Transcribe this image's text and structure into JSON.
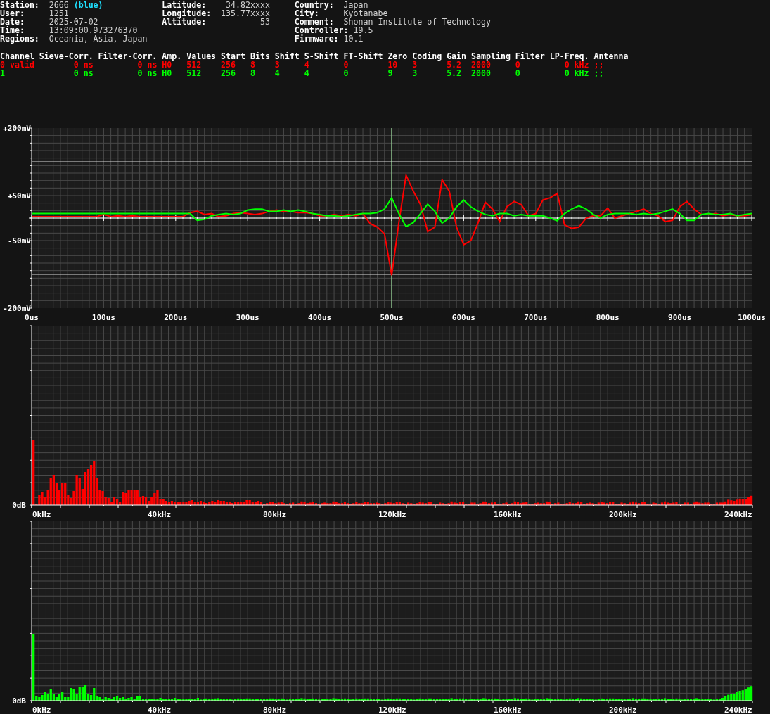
{
  "info_columns": [
    [
      {
        "label": "Station:",
        "value": "2666",
        "tag": "(blue)"
      },
      {
        "label": "User:",
        "value": "1251"
      },
      {
        "label": "Date:",
        "value": "2025-07-02"
      },
      {
        "label": "Time:",
        "value": "13:09:00.973276370"
      },
      {
        "label": "Regions:",
        "value": "Oceania, Asia, Japan"
      }
    ],
    [
      {
        "label": "Latitude:",
        "value": "34.82xxxx"
      },
      {
        "label": "Longitude:",
        "value": "135.77xxxx"
      },
      {
        "label": "Altitude:",
        "value": "53"
      }
    ],
    [
      {
        "label": "Country:",
        "value": "Japan"
      },
      {
        "label": "City:",
        "value": "Kyotanabe"
      },
      {
        "label": "Comment:",
        "value": "Shonan Institute of Technology"
      },
      {
        "label": "Controller:",
        "value": "19.5"
      },
      {
        "label": "Firmware:",
        "value": "10.1"
      }
    ]
  ],
  "channel_table": {
    "columns": [
      "Channel",
      "Sieve-Corr.",
      "Filter-Corr.",
      "Amp.",
      "Values",
      "Start",
      "Bits",
      "Shift",
      "S-Shift",
      "FT-Shift",
      "Zero",
      "Coding",
      "Gain",
      "Sampling",
      "Filter",
      "LP-Freq.",
      "Antenna"
    ],
    "rows": [
      {
        "color": "#ff0000",
        "cells": [
          "0 valid",
          "0 ns",
          "0 ns",
          "H0",
          "512",
          "256",
          "8",
          "3",
          "4",
          "0",
          "10",
          "3",
          "5.2",
          "2000",
          "0",
          "0 kHz",
          ";;"
        ]
      },
      {
        "color": "#00ff00",
        "cells": [
          "1",
          "0 ns",
          "0 ns",
          "H0",
          "512",
          "256",
          "8",
          "4",
          "4",
          "0",
          "9",
          "3",
          "5.2",
          "2000",
          "0",
          "0 kHz",
          ";;"
        ]
      }
    ]
  },
  "waveform": {
    "chart_data": {
      "type": "line",
      "ylim": [
        -200,
        200
      ],
      "xlim": [
        0,
        1000
      ],
      "x": [
        0,
        10,
        20,
        30,
        40,
        50,
        60,
        70,
        80,
        90,
        100,
        110,
        120,
        130,
        140,
        150,
        160,
        170,
        180,
        190,
        200,
        210,
        220,
        230,
        240,
        250,
        260,
        270,
        280,
        290,
        300,
        310,
        320,
        330,
        340,
        350,
        360,
        370,
        380,
        390,
        400,
        410,
        420,
        430,
        440,
        450,
        460,
        470,
        480,
        490,
        500,
        510,
        520,
        530,
        540,
        550,
        560,
        570,
        580,
        590,
        600,
        610,
        620,
        630,
        640,
        650,
        660,
        670,
        680,
        690,
        700,
        710,
        720,
        730,
        740,
        750,
        760,
        770,
        780,
        790,
        800,
        810,
        820,
        830,
        840,
        850,
        860,
        870,
        880,
        890,
        900,
        910,
        920,
        930,
        940,
        950,
        960,
        970,
        980,
        990,
        1000
      ],
      "series": [
        {
          "color": "#ff0000",
          "values": [
            3,
            3,
            3,
            3,
            3,
            3,
            3,
            3,
            3,
            3,
            8,
            3,
            5,
            3,
            5,
            3,
            3,
            3,
            3,
            3,
            3,
            3,
            12,
            15,
            8,
            10,
            3,
            5,
            10,
            12,
            10,
            8,
            10,
            15,
            18,
            15,
            15,
            12,
            12,
            10,
            5,
            5,
            8,
            5,
            8,
            5,
            10,
            -12,
            -20,
            -35,
            -127,
            -10,
            95,
            60,
            30,
            -30,
            -20,
            85,
            60,
            -20,
            -59,
            -50,
            -10,
            35,
            20,
            -8,
            25,
            37,
            30,
            5,
            10,
            40,
            45,
            55,
            -15,
            -23,
            -20,
            0,
            5,
            5,
            22,
            0,
            5,
            10,
            15,
            20,
            10,
            5,
            -8,
            -5,
            25,
            37,
            20,
            8,
            8,
            10,
            5,
            8,
            5,
            5,
            8
          ]
        },
        {
          "color": "#00ff00",
          "values": [
            10,
            10,
            10,
            10,
            10,
            10,
            10,
            10,
            10,
            10,
            10,
            10,
            10,
            10,
            10,
            10,
            10,
            10,
            10,
            10,
            10,
            10,
            10,
            -5,
            -3,
            5,
            8,
            10,
            8,
            10,
            18,
            20,
            20,
            15,
            15,
            18,
            15,
            18,
            15,
            10,
            8,
            5,
            5,
            3,
            5,
            8,
            10,
            10,
            12,
            20,
            45,
            10,
            -19,
            -10,
            10,
            31,
            15,
            -11,
            0,
            25,
            40,
            25,
            15,
            8,
            5,
            10,
            10,
            5,
            8,
            5,
            5,
            5,
            0,
            -6,
            10,
            20,
            27,
            20,
            8,
            0,
            8,
            10,
            10,
            10,
            8,
            10,
            8,
            10,
            15,
            20,
            10,
            -5,
            -5,
            8,
            10,
            8,
            8,
            10,
            5,
            8,
            10
          ]
        }
      ],
      "xticks": [
        {
          "value": 0,
          "label": "0us"
        },
        {
          "value": 100,
          "label": "100us"
        },
        {
          "value": 200,
          "label": "200us"
        },
        {
          "value": 300,
          "label": "300us"
        },
        {
          "value": 400,
          "label": "400us"
        },
        {
          "value": 500,
          "label": "500us"
        },
        {
          "value": 600,
          "label": "600us"
        },
        {
          "value": 700,
          "label": "700us"
        },
        {
          "value": 800,
          "label": "800us"
        },
        {
          "value": 900,
          "label": "900us"
        },
        {
          "value": 1000,
          "label": "1000us"
        }
      ],
      "yticks": [
        {
          "value": 200,
          "label": "+200mV"
        },
        {
          "value": 50,
          "label": "+50mV"
        },
        {
          "value": -50,
          "label": "-50mV"
        },
        {
          "value": -200,
          "label": "-200mV"
        }
      ],
      "grid": true,
      "ref_lines": [
        {
          "axis": "y",
          "value": 125
        },
        {
          "axis": "y",
          "value": -125
        },
        {
          "axis": "x",
          "value": 500
        }
      ]
    }
  },
  "spectra": [
    {
      "color": "#ff0000",
      "y_label": "0dB",
      "x_labels": [
        "0kHz",
        "40kHz",
        "80kHz",
        "120kHz",
        "160kHz",
        "200kHz",
        "240kHz"
      ]
    },
    {
      "color": "#00ff00",
      "y_label": "0dB",
      "x_labels": [
        "0kHz",
        "40kHz",
        "80kHz",
        "120kHz",
        "160kHz",
        "200kHz",
        "240kHz"
      ]
    }
  ]
}
